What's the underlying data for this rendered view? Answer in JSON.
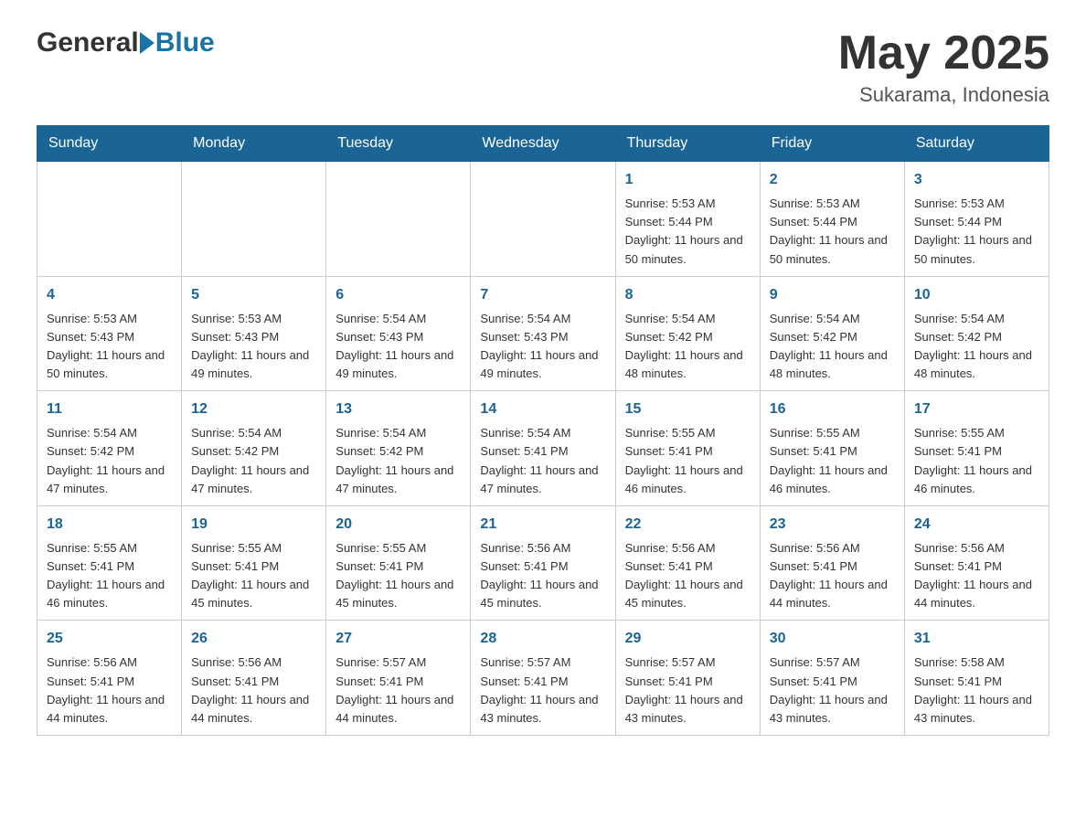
{
  "header": {
    "logo": {
      "general": "General",
      "blue": "Blue"
    },
    "title": "May 2025",
    "location": "Sukarama, Indonesia"
  },
  "calendar": {
    "days_of_week": [
      "Sunday",
      "Monday",
      "Tuesday",
      "Wednesday",
      "Thursday",
      "Friday",
      "Saturday"
    ],
    "weeks": [
      [
        {
          "day": "",
          "info": ""
        },
        {
          "day": "",
          "info": ""
        },
        {
          "day": "",
          "info": ""
        },
        {
          "day": "",
          "info": ""
        },
        {
          "day": "1",
          "info": "Sunrise: 5:53 AM\nSunset: 5:44 PM\nDaylight: 11 hours and 50 minutes."
        },
        {
          "day": "2",
          "info": "Sunrise: 5:53 AM\nSunset: 5:44 PM\nDaylight: 11 hours and 50 minutes."
        },
        {
          "day": "3",
          "info": "Sunrise: 5:53 AM\nSunset: 5:44 PM\nDaylight: 11 hours and 50 minutes."
        }
      ],
      [
        {
          "day": "4",
          "info": "Sunrise: 5:53 AM\nSunset: 5:43 PM\nDaylight: 11 hours and 50 minutes."
        },
        {
          "day": "5",
          "info": "Sunrise: 5:53 AM\nSunset: 5:43 PM\nDaylight: 11 hours and 49 minutes."
        },
        {
          "day": "6",
          "info": "Sunrise: 5:54 AM\nSunset: 5:43 PM\nDaylight: 11 hours and 49 minutes."
        },
        {
          "day": "7",
          "info": "Sunrise: 5:54 AM\nSunset: 5:43 PM\nDaylight: 11 hours and 49 minutes."
        },
        {
          "day": "8",
          "info": "Sunrise: 5:54 AM\nSunset: 5:42 PM\nDaylight: 11 hours and 48 minutes."
        },
        {
          "day": "9",
          "info": "Sunrise: 5:54 AM\nSunset: 5:42 PM\nDaylight: 11 hours and 48 minutes."
        },
        {
          "day": "10",
          "info": "Sunrise: 5:54 AM\nSunset: 5:42 PM\nDaylight: 11 hours and 48 minutes."
        }
      ],
      [
        {
          "day": "11",
          "info": "Sunrise: 5:54 AM\nSunset: 5:42 PM\nDaylight: 11 hours and 47 minutes."
        },
        {
          "day": "12",
          "info": "Sunrise: 5:54 AM\nSunset: 5:42 PM\nDaylight: 11 hours and 47 minutes."
        },
        {
          "day": "13",
          "info": "Sunrise: 5:54 AM\nSunset: 5:42 PM\nDaylight: 11 hours and 47 minutes."
        },
        {
          "day": "14",
          "info": "Sunrise: 5:54 AM\nSunset: 5:41 PM\nDaylight: 11 hours and 47 minutes."
        },
        {
          "day": "15",
          "info": "Sunrise: 5:55 AM\nSunset: 5:41 PM\nDaylight: 11 hours and 46 minutes."
        },
        {
          "day": "16",
          "info": "Sunrise: 5:55 AM\nSunset: 5:41 PM\nDaylight: 11 hours and 46 minutes."
        },
        {
          "day": "17",
          "info": "Sunrise: 5:55 AM\nSunset: 5:41 PM\nDaylight: 11 hours and 46 minutes."
        }
      ],
      [
        {
          "day": "18",
          "info": "Sunrise: 5:55 AM\nSunset: 5:41 PM\nDaylight: 11 hours and 46 minutes."
        },
        {
          "day": "19",
          "info": "Sunrise: 5:55 AM\nSunset: 5:41 PM\nDaylight: 11 hours and 45 minutes."
        },
        {
          "day": "20",
          "info": "Sunrise: 5:55 AM\nSunset: 5:41 PM\nDaylight: 11 hours and 45 minutes."
        },
        {
          "day": "21",
          "info": "Sunrise: 5:56 AM\nSunset: 5:41 PM\nDaylight: 11 hours and 45 minutes."
        },
        {
          "day": "22",
          "info": "Sunrise: 5:56 AM\nSunset: 5:41 PM\nDaylight: 11 hours and 45 minutes."
        },
        {
          "day": "23",
          "info": "Sunrise: 5:56 AM\nSunset: 5:41 PM\nDaylight: 11 hours and 44 minutes."
        },
        {
          "day": "24",
          "info": "Sunrise: 5:56 AM\nSunset: 5:41 PM\nDaylight: 11 hours and 44 minutes."
        }
      ],
      [
        {
          "day": "25",
          "info": "Sunrise: 5:56 AM\nSunset: 5:41 PM\nDaylight: 11 hours and 44 minutes."
        },
        {
          "day": "26",
          "info": "Sunrise: 5:56 AM\nSunset: 5:41 PM\nDaylight: 11 hours and 44 minutes."
        },
        {
          "day": "27",
          "info": "Sunrise: 5:57 AM\nSunset: 5:41 PM\nDaylight: 11 hours and 44 minutes."
        },
        {
          "day": "28",
          "info": "Sunrise: 5:57 AM\nSunset: 5:41 PM\nDaylight: 11 hours and 43 minutes."
        },
        {
          "day": "29",
          "info": "Sunrise: 5:57 AM\nSunset: 5:41 PM\nDaylight: 11 hours and 43 minutes."
        },
        {
          "day": "30",
          "info": "Sunrise: 5:57 AM\nSunset: 5:41 PM\nDaylight: 11 hours and 43 minutes."
        },
        {
          "day": "31",
          "info": "Sunrise: 5:58 AM\nSunset: 5:41 PM\nDaylight: 11 hours and 43 minutes."
        }
      ]
    ]
  }
}
